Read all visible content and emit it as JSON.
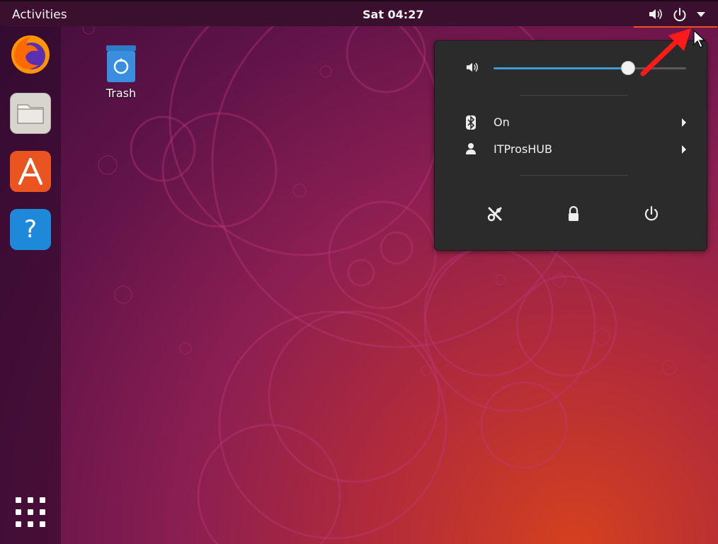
{
  "topbar": {
    "activities_label": "Activities",
    "clock": "Sat 04:27",
    "volume_icon": "speaker-icon",
    "power_icon": "power-icon",
    "menu_arrow_icon": "caret-down-icon",
    "accent_color": "#e95420"
  },
  "dock": {
    "items": [
      {
        "name": "Firefox",
        "icon": "firefox-icon"
      },
      {
        "name": "Files",
        "icon": "folder-icon"
      },
      {
        "name": "Ubuntu Software",
        "icon": "software-store-icon"
      },
      {
        "name": "Help",
        "icon": "help-icon",
        "glyph": "?"
      }
    ],
    "show_apps_icon": "app-grid-icon"
  },
  "desktop": {
    "icons": [
      {
        "label": "Trash",
        "icon": "trash-icon"
      }
    ]
  },
  "system_menu": {
    "volume": {
      "icon": "speaker-icon",
      "level": 0.7
    },
    "bluetooth": {
      "icon": "bluetooth-icon",
      "label": "On"
    },
    "user": {
      "icon": "user-icon",
      "label": "ITProsHUB"
    },
    "actions": [
      {
        "icon": "settings-tools-icon"
      },
      {
        "icon": "lock-icon"
      },
      {
        "icon": "power-icon"
      }
    ],
    "slider_color": "#3e9bd6"
  }
}
